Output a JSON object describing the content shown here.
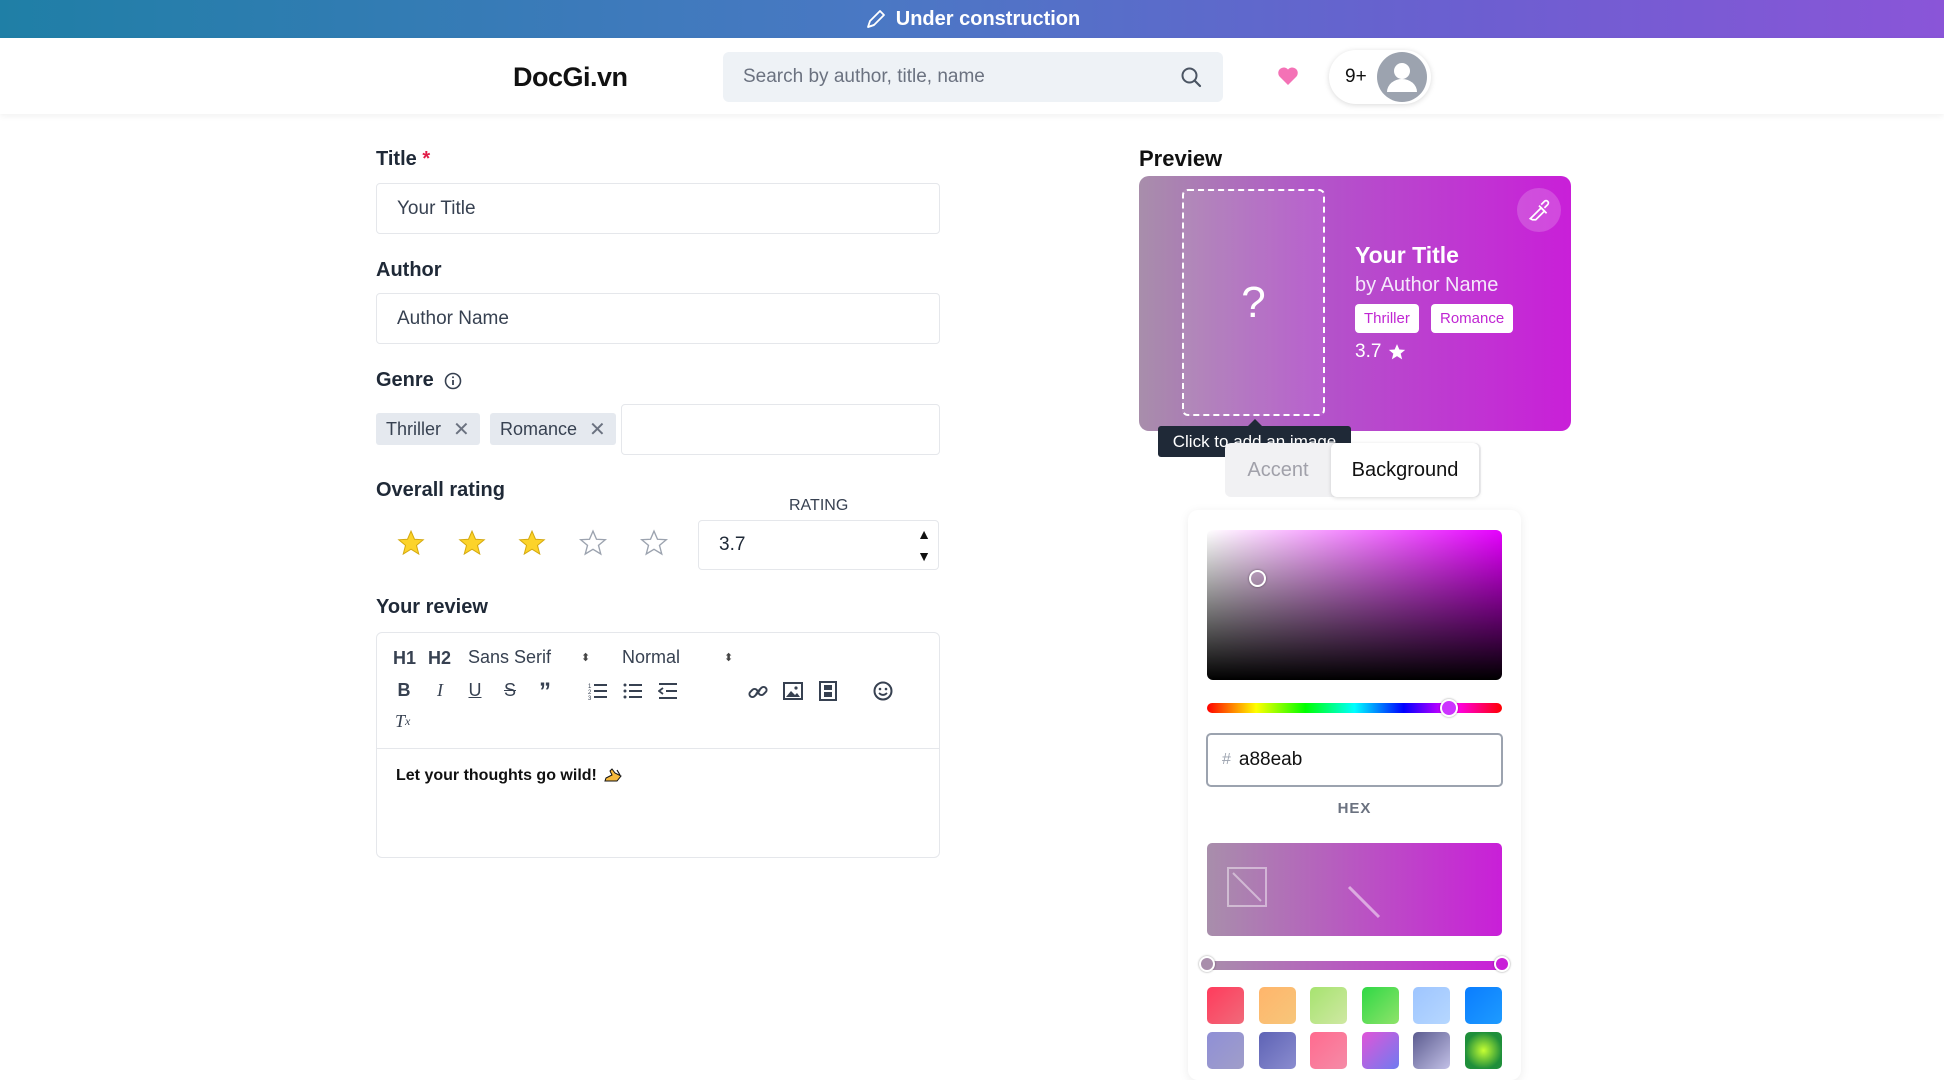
{
  "banner": {
    "text": "Under construction"
  },
  "nav": {
    "logo": "DocGi.vn",
    "search_placeholder": "Search by author, title, name",
    "notif_count": "9+"
  },
  "form": {
    "title_label": "Title",
    "required_mark": "*",
    "title_value": "Your Title",
    "author_label": "Author",
    "author_value": "Author Name",
    "genre_label": "Genre",
    "genres": [
      "Thriller",
      "Romance"
    ],
    "rating_label": "Overall rating",
    "rating_field_label": "RATING",
    "rating_value": "3.7",
    "stars_filled": 3,
    "stars_total": 5,
    "review_label": "Your review",
    "editor": {
      "h1": "H1",
      "h2": "H2",
      "font": "Sans Serif",
      "size": "Normal",
      "placeholder_text": "Let your thoughts go wild!"
    }
  },
  "preview": {
    "label": "Preview",
    "title": "Your Title",
    "author": "by Author Name",
    "genres": [
      "Thriller",
      "Romance"
    ],
    "rating": "3.7",
    "image_placeholder": "?",
    "tooltip": "Click to add an image",
    "tabs": [
      "Accent",
      "Background"
    ],
    "active_tab": "Background"
  },
  "color_picker": {
    "hex_value": "a88eab",
    "hex_label": "HEX",
    "hash": "#",
    "gradient_start": "#a88eab",
    "gradient_end": "#c91fd8",
    "swatches": [
      [
        "#ff3b5c",
        "#f06a7a"
      ],
      [
        "#ffb56b",
        "#f7c67a"
      ],
      [
        "#a6e36f",
        "#cfe8a3"
      ],
      [
        "#2fd845",
        "#8fe36a"
      ],
      [
        "#9ec5ff",
        "#b6d7ff"
      ],
      [
        "#0a7dff",
        "#1e9bff"
      ],
      [
        "#8f8fd6",
        "#a09ec9"
      ],
      [
        "#5e63b5",
        "#8a8ccf"
      ],
      [
        "#ff6b8f",
        "#f58ba7"
      ],
      [
        "#e055d8",
        "#6f7bf0"
      ],
      [
        "#5b5b8f",
        "#c2c0e6"
      ],
      [
        "#1f8f3a",
        "#c6ff33"
      ]
    ]
  }
}
